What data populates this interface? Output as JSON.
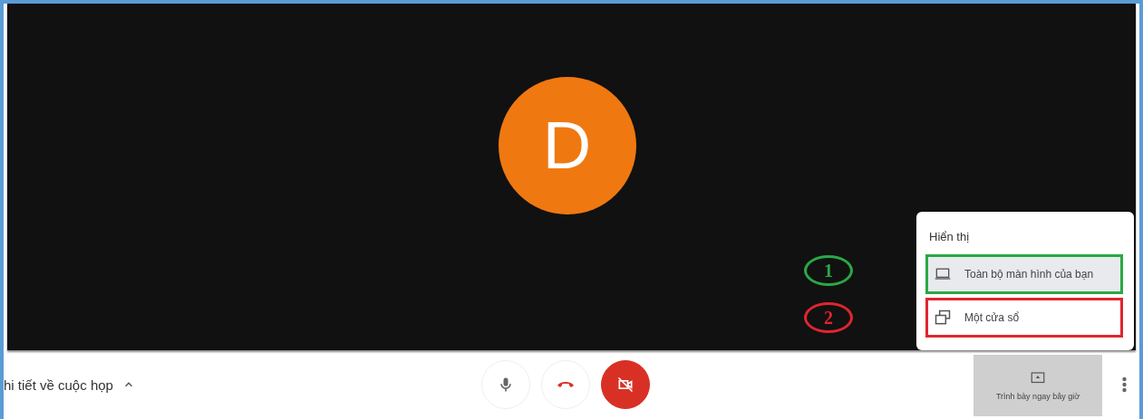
{
  "stage": {
    "avatar_letter": "D"
  },
  "share_menu": {
    "heading": "Hiển thị",
    "items": [
      {
        "kind": "screen",
        "label": "Toàn bộ màn hình của bạn",
        "highlighted": true,
        "color": "#2aa845"
      },
      {
        "kind": "window",
        "label": "Một cửa sổ",
        "highlighted": false,
        "color": "#e0252f"
      }
    ]
  },
  "annotations": [
    {
      "label": "1",
      "color": "#2aa845"
    },
    {
      "label": "2",
      "color": "#e0252f"
    }
  ],
  "bottom_bar": {
    "meeting_details": "hi tiết về cuộc họp",
    "controls": [
      {
        "kind": "mic",
        "off": false
      },
      {
        "kind": "hangup",
        "off": false
      },
      {
        "kind": "camera",
        "off": true
      }
    ],
    "present_button": "Trình bày ngay bây giờ"
  }
}
